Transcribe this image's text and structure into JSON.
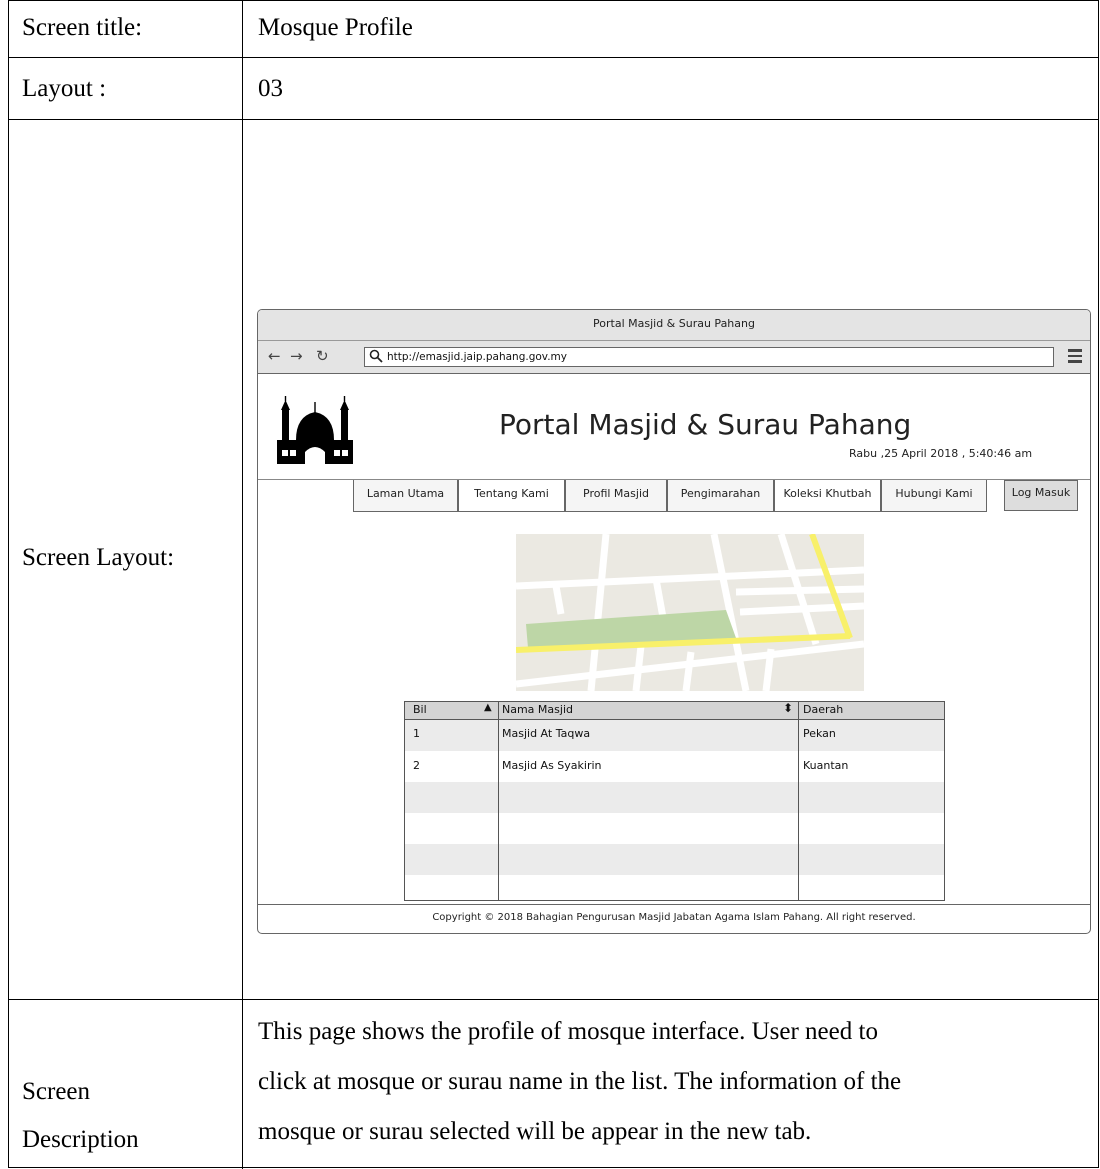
{
  "table": {
    "screen_title_label": "Screen title:",
    "screen_title_value": "Mosque Profile",
    "layout_label": "Layout :",
    "layout_value": "03",
    "screen_layout_label": "Screen Layout:",
    "description_label_line1": "Screen",
    "description_label_line2": "Description",
    "description_line1": "This page shows the profile of mosque interface. User need to",
    "description_line2": "click at mosque or surau name in the list. The information of the",
    "description_line3": "mosque or surau selected will be appear in the new tab."
  },
  "browser": {
    "window_title": "Portal Masjid & Surau Pahang",
    "url": "http://emasjid.jaip.pahang.gov.my",
    "back_icon": "back-arrow-icon",
    "forward_icon": "forward-arrow-icon",
    "reload_icon": "reload-icon",
    "menu_icon": "hamburger-menu-icon"
  },
  "site": {
    "title": "Portal Masjid & Surau Pahang",
    "datetime": "Rabu ,25 April 2018 , 5:40:46 am",
    "logo_icon": "mosque-silhouette-icon",
    "nav": [
      "Laman Utama",
      "Tentang Kami",
      "Profil Masjid",
      "Pengimarahan",
      "Koleksi Khutbah",
      "Hubungi Kami"
    ],
    "login": "Log Masuk",
    "footer": "Copyright © 2018 Bahagian Pengurusan Masjid Jabatan Agama Islam Pahang. All right reserved."
  },
  "mosque_table": {
    "columns": [
      "Bil",
      "Nama Masjid",
      "Daerah"
    ],
    "rows": [
      [
        "1",
        "Masjid At Taqwa",
        "Pekan"
      ],
      [
        "2",
        "Masjid As Syakirin",
        "Kuantan"
      ]
    ]
  },
  "colors": {
    "map_road_yellow": "#f8f06a",
    "map_park_green": "#bdd6a6",
    "map_ground": "#ebe9e2"
  }
}
